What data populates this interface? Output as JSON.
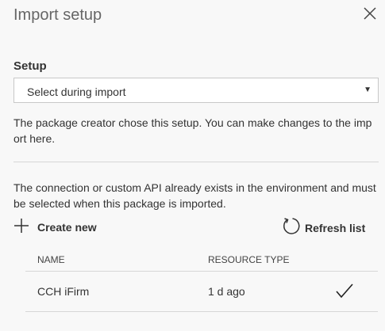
{
  "header": {
    "title": "Import setup",
    "close_icon": "close-icon"
  },
  "setup": {
    "label": "Setup",
    "selected": "Select during import",
    "description": "The package creator chose this setup. You can make changes to the import here."
  },
  "connection": {
    "description": "The connection or custom API already exists in the environment and must be selected when this package is imported."
  },
  "actions": {
    "create_new": "Create new",
    "refresh_list": "Refresh list"
  },
  "table": {
    "columns": [
      "NAME",
      "RESOURCE TYPE"
    ],
    "rows": [
      {
        "name": "CCH iFirm",
        "resource_type": "1 d ago",
        "selected": true
      }
    ]
  }
}
